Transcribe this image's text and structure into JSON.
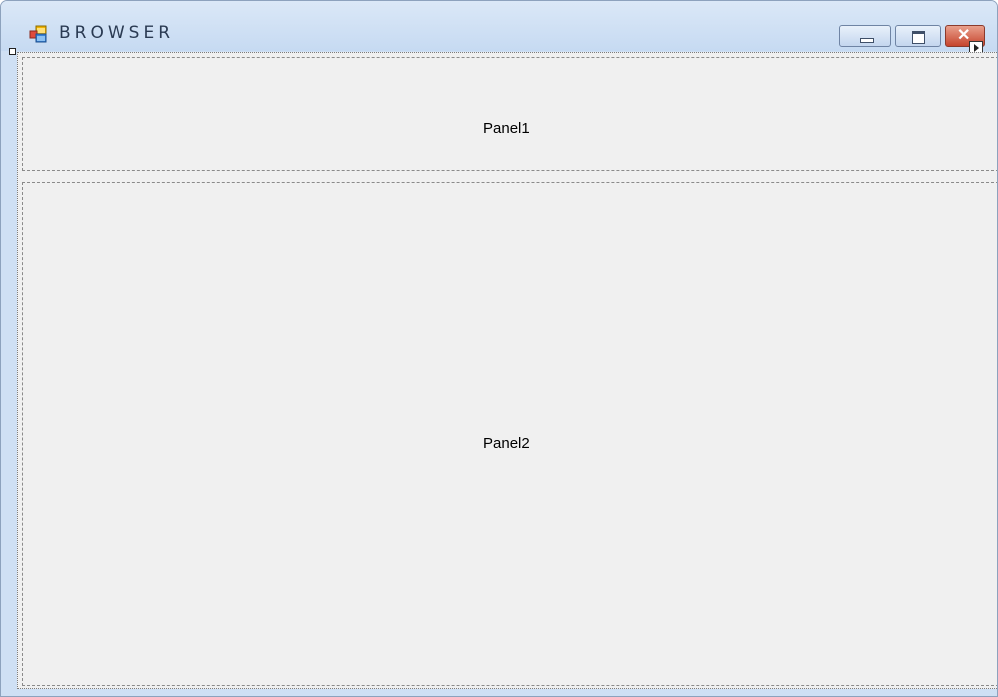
{
  "window": {
    "title": "BROWSER",
    "buttons": {
      "minimize_icon": "minimize-icon",
      "maximize_icon": "maximize-icon",
      "close_icon": "close-icon",
      "close_glyph": "✕"
    }
  },
  "splitter": {
    "panel1_label": "Panel1",
    "panel2_label": "Panel2"
  }
}
